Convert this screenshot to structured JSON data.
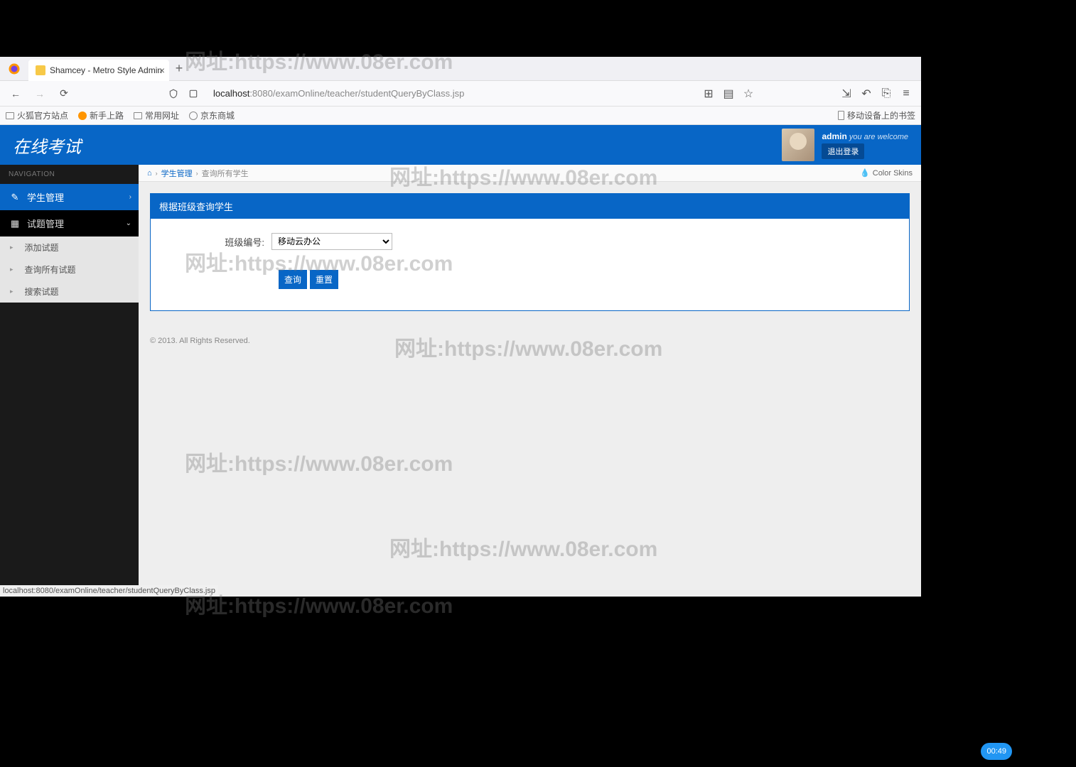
{
  "browser": {
    "tab_title": "Shamcey - Metro Style Admin",
    "url_host": "localhost",
    "url_path": ":8080/examOnline/teacher/studentQueryByClass.jsp",
    "bookmarks": [
      "火狐官方站点",
      "新手上路",
      "常用网址",
      "京东商城"
    ],
    "bookmark_right": "移动设备上的书签",
    "status_url": "localhost:8080/examOnline/teacher/studentQueryByClass.jsp"
  },
  "header": {
    "logo": "在线考试",
    "username": "admin",
    "welcome": "you are welcome",
    "logout": "退出登录"
  },
  "sidebar": {
    "title": "NAVIGATION",
    "items": [
      {
        "label": "学生管理"
      },
      {
        "label": "试题管理"
      }
    ],
    "sub_items": [
      "添加试题",
      "查询所有试题",
      "搜索试题"
    ]
  },
  "breadcrumb": {
    "link": "学生管理",
    "current": "查询所有学生",
    "skins": "Color Skins"
  },
  "panel": {
    "title": "根据班级查询学生",
    "form_label": "班级编号:",
    "select_value": "移动云办公",
    "btn_query": "查询",
    "btn_reset": "重置"
  },
  "footer": "© 2013. All Rights Reserved.",
  "watermark": "网址:https://www.08er.com",
  "timer": "00:49"
}
